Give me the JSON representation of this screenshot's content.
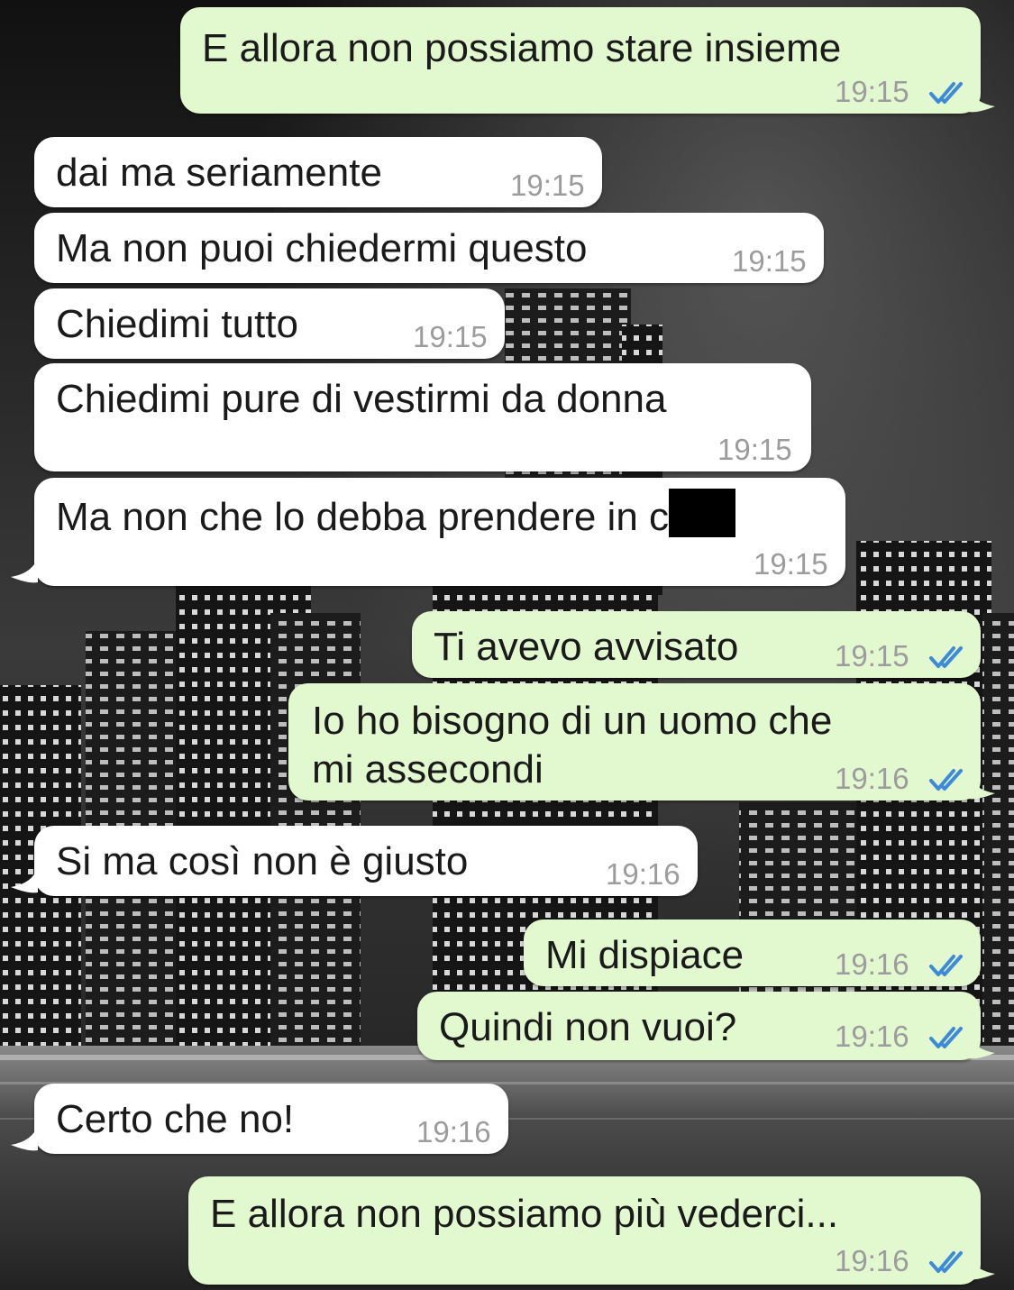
{
  "colors": {
    "incoming_bubble": "#ffffff",
    "outgoing_bubble": "#e2f8cf",
    "read_ticks": "#3d8ad6",
    "timestamp": "#9c9c9c"
  },
  "messages": [
    {
      "direction": "out",
      "text": "E allora non possiamo stare insieme",
      "time": "19:15",
      "status": "read-double-tick-icon"
    },
    {
      "direction": "in",
      "text": "dai ma seriamente",
      "time": "19:15"
    },
    {
      "direction": "in",
      "text": "Ma non puoi chiedermi questo",
      "time": "19:15"
    },
    {
      "direction": "in",
      "text": "Chiedimi tutto",
      "time": "19:15"
    },
    {
      "direction": "in",
      "text": "Chiedimi pure di vestirmi da donna",
      "time": "19:15"
    },
    {
      "direction": "in",
      "text": "Ma non che lo debba prendere in c",
      "time": "19:15",
      "redacted": true
    },
    {
      "direction": "out",
      "text": "Ti avevo avvisato",
      "time": "19:15",
      "status": "read-double-tick-icon"
    },
    {
      "direction": "out",
      "text_line1": "Io ho bisogno di un uomo che",
      "text_line2": "mi assecondi",
      "time": "19:16",
      "status": "read-double-tick-icon"
    },
    {
      "direction": "in",
      "text": "Si ma così non è giusto",
      "time": "19:16"
    },
    {
      "direction": "out",
      "text": "Mi dispiace",
      "time": "19:16",
      "status": "read-double-tick-icon"
    },
    {
      "direction": "out",
      "text": "Quindi non vuoi?",
      "time": "19:16",
      "status": "read-double-tick-icon"
    },
    {
      "direction": "in",
      "text": "Certo che no!",
      "time": "19:16"
    },
    {
      "direction": "out",
      "text": "E allora non possiamo più vederci...",
      "time": "19:16",
      "status": "read-double-tick-icon"
    }
  ]
}
